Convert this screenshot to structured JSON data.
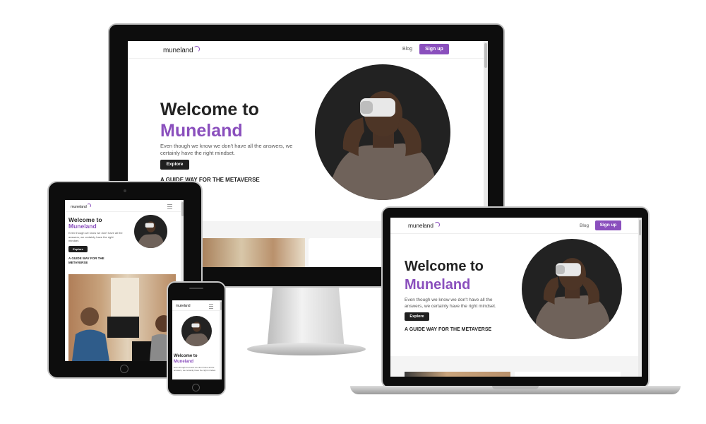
{
  "site": {
    "logo": "muneland",
    "nav": {
      "blog": "Blog",
      "signup": "Sign up"
    },
    "hero": {
      "heading_line1": "Welcome to",
      "heading_line2": "Muneland",
      "subtitle": "Even though we know we don't have all the answers, we certainly have the right mindset.",
      "explore": "Explore",
      "tagline": "A GUIDE WAY FOR THE METAVERSE"
    }
  },
  "tablet": {
    "tagline_short": "A GUIDE WAY FOR THE METAVERSE"
  },
  "phone": {
    "heading_line1": "Welcome to",
    "heading_line2": "Muneland",
    "subtitle": "Even though we know we don't have all the answers, we certainly have the right mindset."
  },
  "icons": [
    "hamburger-menu-icon",
    "vr-headset-person-photo",
    "interview-photo"
  ],
  "colors": {
    "accent": "#8a4fbd",
    "dark": "#1f1f1f",
    "circle": "#222222"
  }
}
